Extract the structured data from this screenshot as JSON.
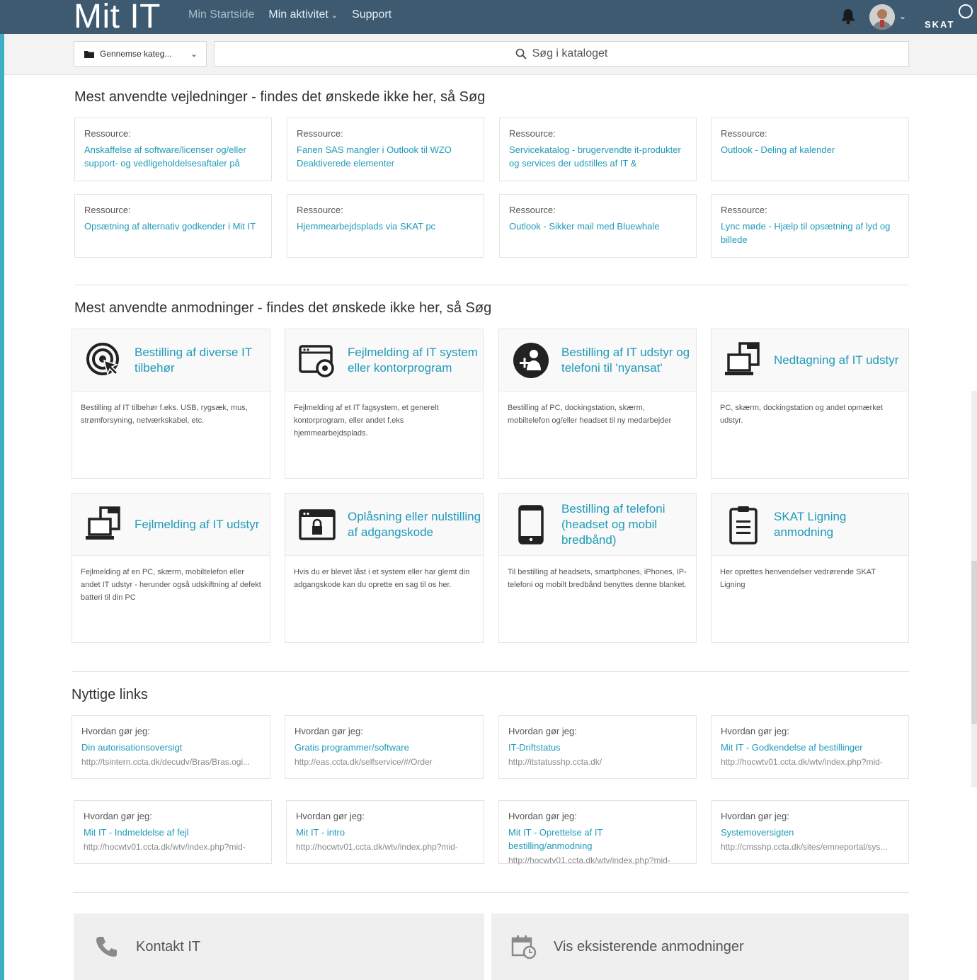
{
  "header": {
    "brand": "Mit IT",
    "nav": [
      {
        "label": "Min Startside"
      },
      {
        "label": "Min aktivitet",
        "caret": "⌄"
      },
      {
        "label": "Support"
      }
    ],
    "org_logo": "SKAT"
  },
  "subbar": {
    "browse_label": "Gennemse kateg...",
    "search_placeholder": "Søg i kataloget"
  },
  "guides": {
    "title": "Mest anvendte vejledninger - findes det ønskede ikke her, så Søg",
    "items": [
      {
        "kicker": "Ressource:",
        "title": "Anskaffelse af software/licenser og/eller support- og vedligeholdelsesaftaler på"
      },
      {
        "kicker": "Ressource:",
        "title": "Fanen SAS mangler i Outlook til WZO Deaktiverede elementer"
      },
      {
        "kicker": "Ressource:",
        "title": "Servicekatalog - brugervendte it-produkter og services der udstilles af IT &"
      },
      {
        "kicker": "Ressource:",
        "title": "Outlook - Deling af kalender"
      },
      {
        "kicker": "Ressource:",
        "title": "Opsætning af alternativ godkender i Mit IT"
      },
      {
        "kicker": "Ressource:",
        "title": "Hjemmearbejdsplads via SKAT pc"
      },
      {
        "kicker": "Ressource:",
        "title": "Outlook - Sikker mail med Bluewhale"
      },
      {
        "kicker": "Ressource:",
        "title": "Lync møde - Hjælp til opsætning af lyd og billede"
      }
    ]
  },
  "requests": {
    "title": "Mest anvendte anmodninger - findes det ønskede ikke her, så Søg",
    "items": [
      {
        "icon": "target-cursor-icon",
        "title": "Bestilling af diverse IT tilbehør",
        "desc": "Bestilling af IT tilbehør f.eks. USB, rygsæk, mus, strømforsyning, netværkskabel, etc."
      },
      {
        "icon": "window-gear-icon",
        "title": "Fejlmelding af IT system eller kontorprogram",
        "desc": "Fejlmelding af et IT fagsystem, et generelt kontorprogram, eller andet f.eks hjemmearbejdsplads."
      },
      {
        "icon": "new-employee-icon",
        "title": "Bestilling af IT udstyr og telefoni til 'nyansat'",
        "desc": "Bestilling af PC, dockingstation, skærm, mobiltelefon og/eller headset til ny medarbejder"
      },
      {
        "icon": "devices-icon",
        "title": "Nedtagning af IT udstyr",
        "desc": "PC, skærm, dockingstation og andet opmærket udstyr."
      },
      {
        "icon": "devices-icon",
        "title": "Fejlmelding af IT udstyr",
        "desc": "Fejlmelding af en PC, skærm, mobiltelefon eller andet IT udstyr - herunder også udskiftning af defekt batteri til din PC"
      },
      {
        "icon": "window-lock-icon",
        "title": "Oplåsning eller nulstilling af adgangskode",
        "desc": "Hvis du er blevet låst i et system eller har glemt din adgangskode kan du oprette en sag til os her."
      },
      {
        "icon": "smartphone-icon",
        "title": "Bestilling af telefoni (headset og mobil bredbånd)",
        "desc": "Til bestilling af headsets, smartphones, iPhones, IP-telefoni og mobilt bredbånd benyttes denne blanket."
      },
      {
        "icon": "clipboard-icon",
        "title": "SKAT Ligning anmodning",
        "desc": "Her oprettes henvendelser vedrørende SKAT Ligning"
      }
    ]
  },
  "links": {
    "title": "Nyttige links",
    "items": [
      {
        "kicker": "Hvordan gør jeg:",
        "title": "Din autorisationsoversigt",
        "url": "http://tsintern.ccta.dk/decudv/Bras/Bras.ogi..."
      },
      {
        "kicker": "Hvordan gør jeg:",
        "title": "Gratis programmer/software",
        "url": "http://eas.ccta.dk/selfservice/#/Order"
      },
      {
        "kicker": "Hvordan gør jeg:",
        "title": "IT-Driftstatus",
        "url": "http://itstatusshp.ccta.dk/"
      },
      {
        "kicker": "Hvordan gør jeg:",
        "title": "Mit IT - Godkendelse af bestillinger",
        "url": "http://hocwtv01.ccta.dk/wtv/index.php?mid-"
      },
      {
        "kicker": "Hvordan gør jeg:",
        "title": "Mit IT - Indmeldelse af fejl",
        "url": "http://hocwtv01.ccta.dk/wtv/index.php?mid-"
      },
      {
        "kicker": "Hvordan gør jeg:",
        "title": "Mit IT - intro",
        "url": "http://hocwtv01.ccta.dk/wtv/index.php?mid-"
      },
      {
        "kicker": "Hvordan gør jeg:",
        "title": "Mit IT - Oprettelse af IT bestilling/anmodning",
        "url": "http://hocwtv01.ccta.dk/wtv/index.php?mid-"
      },
      {
        "kicker": "Hvordan gør jeg:",
        "title": "Systemoversigten",
        "url": "http://cmsshp.ccta.dk/sites/emneportal/sys..."
      }
    ]
  },
  "footer": {
    "contact_label": "Kontakt IT",
    "existing_label": "Vis eksisterende anmodninger"
  },
  "colors": {
    "topbar": "#3d5a70",
    "accent": "#3eaec3",
    "link": "#1f9ab8"
  }
}
